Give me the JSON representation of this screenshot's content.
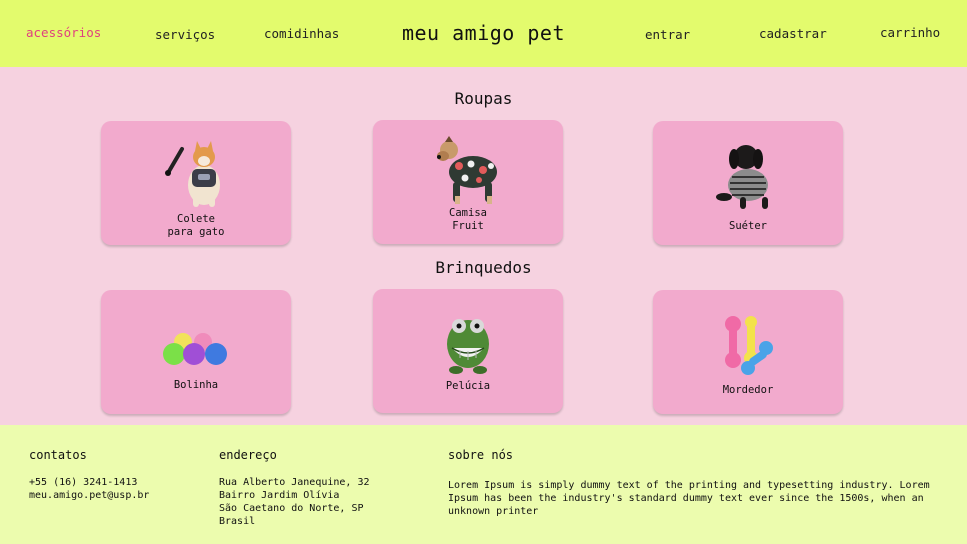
{
  "header": {
    "nav_left": [
      "acessórios",
      "serviços",
      "comidinhas"
    ],
    "brand": "meu amigo pet",
    "nav_right": [
      "entrar",
      "cadastrar",
      "carrinho"
    ],
    "active_color": "#e0417e",
    "background": "#e3fb6d"
  },
  "sections": [
    {
      "title": "Roupas",
      "items": [
        {
          "label": "Colete\npara gato",
          "icon": "cat-with-harness-icon"
        },
        {
          "label": "Camisa\nFruit",
          "icon": "dog-in-shirt-icon"
        },
        {
          "label": "Suéter",
          "icon": "dog-in-sweater-icon"
        }
      ]
    },
    {
      "title": "Brinquedos",
      "items": [
        {
          "label": "Bolinha",
          "icon": "colored-balls-icon"
        },
        {
          "label": "Pelúcia",
          "icon": "plush-toy-icon"
        },
        {
          "label": "Mordedor",
          "icon": "chew-toy-icon"
        }
      ]
    }
  ],
  "footer": {
    "contacts": {
      "title": "contatos",
      "lines": [
        "+55 (16) 3241-1413",
        "meu.amigo.pet@usp.br"
      ]
    },
    "address": {
      "title": "endereço",
      "lines": [
        "Rua Alberto Janequine, 32",
        "Bairro Jardim Olívia",
        "São Caetano do Norte, SP",
        "Brasil"
      ]
    },
    "about": {
      "title": "sobre nós",
      "text": "Lorem Ipsum is simply dummy text of the printing and typesetting industry. Lorem Ipsum has been the industry's standard dummy text ever since the 1500s, when an unknown printer"
    }
  },
  "colors": {
    "page_bg": "#f6d2e0",
    "card_bg": "#f2aacd",
    "footer_bg": "#ecfcae"
  }
}
